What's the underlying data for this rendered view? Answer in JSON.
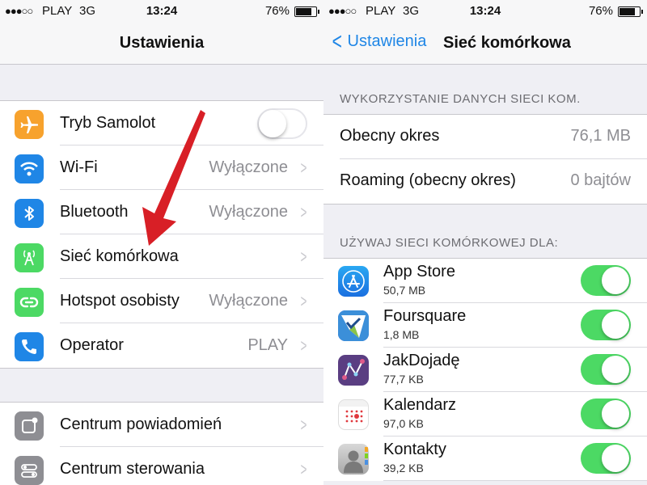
{
  "status_bar": {
    "signal": "●●●○○",
    "carrier": "PLAY",
    "network": "3G",
    "time": "13:24",
    "battery": "76%",
    "battery_fraction": 0.76
  },
  "left": {
    "title": "Ustawienia",
    "group1": [
      {
        "label": "Tryb Samolot",
        "value": "",
        "icon": "airplane-icon",
        "color": "#f7a22d",
        "toggle": "off"
      },
      {
        "label": "Wi-Fi",
        "value": "Wyłączone",
        "icon": "wifi-icon",
        "color": "#1f86e6"
      },
      {
        "label": "Bluetooth",
        "value": "Wyłączone",
        "icon": "bluetooth-icon",
        "color": "#1f86e6"
      },
      {
        "label": "Sieć komórkowa",
        "value": "",
        "icon": "cellular-icon",
        "color": "#4cd964"
      },
      {
        "label": "Hotspot osobisty",
        "value": "Wyłączone",
        "icon": "hotspot-icon",
        "color": "#4cd964"
      },
      {
        "label": "Operator",
        "value": "PLAY",
        "icon": "phone-icon",
        "color": "#1f86e6"
      }
    ],
    "group2": [
      {
        "label": "Centrum powiadomień",
        "icon": "notifications-icon",
        "color": "#8e8e93"
      },
      {
        "label": "Centrum sterowania",
        "icon": "control-center-icon",
        "color": "#8e8e93"
      }
    ]
  },
  "right": {
    "back_label": "Ustawienia",
    "title": "Sieć komórkowa",
    "section1_header": "WYKORZYSTANIE DANYCH SIECI KOM.",
    "usage": [
      {
        "label": "Obecny okres",
        "value": "76,1 MB"
      },
      {
        "label": "Roaming (obecny okres)",
        "value": "0 bajtów"
      }
    ],
    "section2_header": "UŻYWAJ SIECI KOMÓRKOWEJ DLA:",
    "apps": [
      {
        "name": "App Store",
        "size": "50,7 MB",
        "icon": "app-store-icon",
        "enabled": true
      },
      {
        "name": "Foursquare",
        "size": "1,8 MB",
        "icon": "foursquare-icon",
        "enabled": true
      },
      {
        "name": "JakDojadę",
        "size": "77,7 KB",
        "icon": "jakdojade-icon",
        "enabled": true
      },
      {
        "name": "Kalendarz",
        "size": "97,0 KB",
        "icon": "calendar-icon",
        "enabled": true
      },
      {
        "name": "Kontakty",
        "size": "39,2 KB",
        "icon": "contacts-icon",
        "enabled": true
      }
    ]
  },
  "colors": {
    "accent": "#1f86e6",
    "toggle_on": "#4cd964",
    "arrow": "#d81f26"
  }
}
